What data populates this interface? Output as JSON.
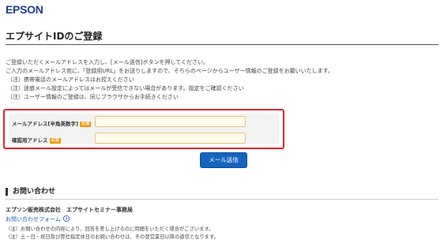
{
  "header": {
    "logo": "EPSON"
  },
  "page": {
    "title": "エプサイトIDのご登録"
  },
  "intro": {
    "line1": "ご登録いただくメールアドレスを入力し、[メール送信]ボタンを押してください。",
    "line2": "ご入力のメールアドレス宛に、「登録用URL」をお送りしますので、そちらのページからユーザー情報のご登録をお願いいたします。",
    "notes": [
      "（注）携帯電話のメールアドレスはお控えください",
      "（注）迷惑メール設定によってはメールが受信できない場合があります。設定をご確認ください",
      "（注）ユーザー情報のご登録は、同じブラウザからお手続きください"
    ]
  },
  "form": {
    "email_label": "メールアドレス[半角英数字]",
    "email_required": "必須",
    "email_value": "",
    "confirm_label": "確認用アドレス",
    "confirm_required": "必須",
    "confirm_value": "",
    "submit_label": "メール送信"
  },
  "contact": {
    "heading": "お問い合わせ",
    "company": "エプソン販売株式会社　エプサイトセミナー事務局",
    "link": "お問い合わせフォーム",
    "link_icon": "circle-arrow-right-icon",
    "notes": [
      "（注）お問い合わせの内容により、回答を差し上げるのに時間をいただく場合がございます。",
      "（注）土・日・祝日及び弊社指定休日のお問い合わせは、その翌営業日以降の返信となります。"
    ]
  },
  "colors": {
    "brand": "#1e3c8c",
    "highlight_border": "#e0272e",
    "button": "#1565c0",
    "required_badge": "#f39800",
    "link": "#1a5fb4"
  }
}
